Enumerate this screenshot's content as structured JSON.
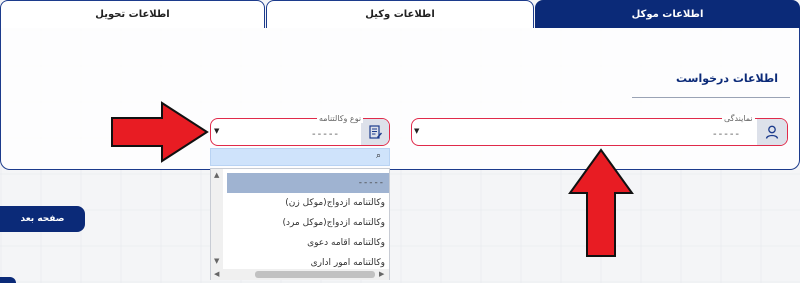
{
  "tabs": {
    "delivery": "اطلاعات تحویل",
    "lawyer": "اطلاعات وکیل",
    "client": "اطلاعات موکل"
  },
  "section": {
    "title": "اطلاعات درخواست"
  },
  "representation": {
    "label": "نمایندگی",
    "value": "-----"
  },
  "poa_type": {
    "label": "نوع وکالتنامه",
    "value": "-----"
  },
  "dropdown": {
    "options": [
      "-----",
      "وکالتنامه ازدواج(موکل زن)",
      "وکالتنامه ازدواج(موکل مرد)",
      "وکالتنامه اقامه دعوی",
      "وکالتنامه امور اداری"
    ]
  },
  "next_button": "صفحه بعد",
  "colors": {
    "accent": "#0b2a78",
    "error_border": "#e02a4a",
    "annotation_arrow": "#e81c23"
  },
  "icons": [
    "user-icon",
    "document-icon",
    "search-icon",
    "caret-down-icon",
    "red-arrow-right",
    "red-arrow-up"
  ]
}
